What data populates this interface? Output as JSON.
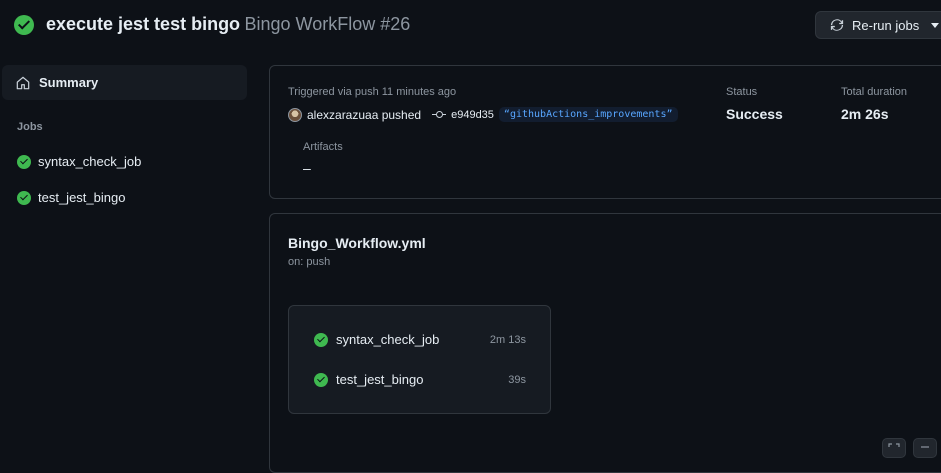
{
  "header": {
    "title": "execute jest test bingo",
    "subtitle": "Bingo WorkFlow #26",
    "rerun_label": "Re-run jobs"
  },
  "sidebar": {
    "summary_label": "Summary",
    "jobs_heading": "Jobs",
    "jobs": [
      {
        "label": "syntax_check_job"
      },
      {
        "label": "test_jest_bingo"
      }
    ]
  },
  "run_info": {
    "triggered": "Triggered via push 11 minutes ago",
    "actor_action": "alexzarazuaa pushed",
    "commit_sha": "e949d35",
    "branch": "“githubActions_improvements”",
    "status_label": "Status",
    "status_value": "Success",
    "duration_label": "Total duration",
    "duration_value": "2m 26s",
    "artifacts_label": "Artifacts",
    "artifacts_value": "–"
  },
  "workflow": {
    "file": "Bingo_Workflow.yml",
    "trigger": "on: push",
    "jobs": [
      {
        "label": "syntax_check_job",
        "duration": "2m 13s"
      },
      {
        "label": "test_jest_bingo",
        "duration": "39s"
      }
    ]
  },
  "colors": {
    "success": "#3fb950",
    "link": "#58a6ff",
    "background": "#0d1117"
  }
}
